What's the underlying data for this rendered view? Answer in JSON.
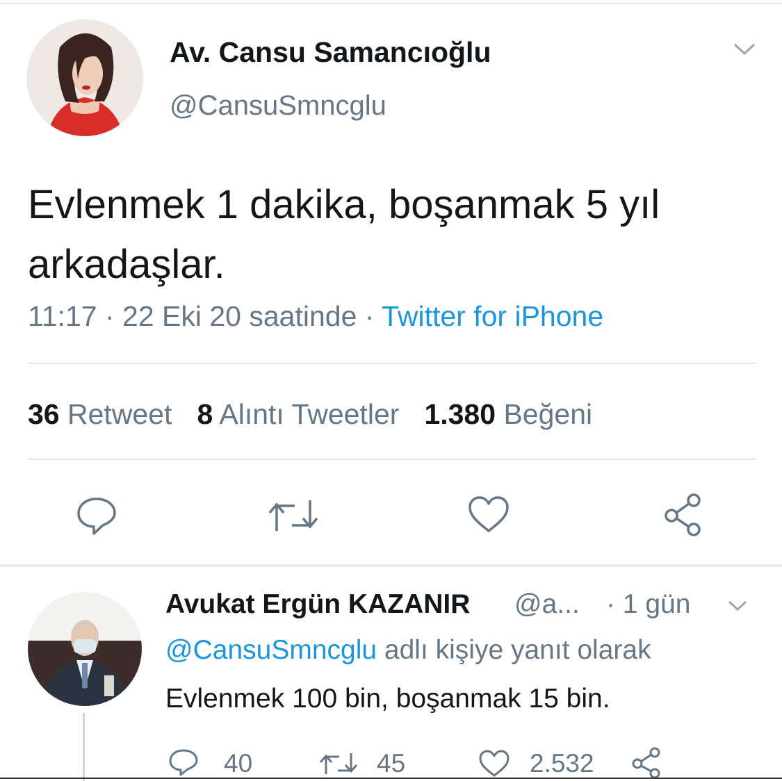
{
  "tweet": {
    "author_name": "Av. Cansu Samancıoğlu",
    "author_handle": "@CansuSmncglu",
    "text": "Evlenmek 1 dakika, boşanmak 5 yıl arkadaşlar.",
    "time": "11:17",
    "date": "22 Eki 20 saatinde",
    "separator": "·",
    "source": "Twitter for iPhone",
    "stats": {
      "retweets_count": "36",
      "retweets_label": "Retweet",
      "quotes_count": "8",
      "quotes_label": "Alıntı Tweetler",
      "likes_count": "1.380",
      "likes_label": "Beğeni"
    },
    "actions": [
      "reply-icon",
      "retweet-icon",
      "like-icon",
      "share-icon"
    ]
  },
  "reply": {
    "author_name": "Avukat Ergün KAZANIR",
    "author_handle": "@a...",
    "time": "· 1 gün",
    "reply_to_handle": "@CansuSmncglu",
    "reply_to_suffix": " adlı kişiye yanıt olarak",
    "text": "Evlenmek 100 bin, boşanmak 15 bin.",
    "reply_count": "40",
    "retweet_count": "45",
    "like_count": "2.532"
  },
  "colors": {
    "primary_text": "#14171a",
    "secondary_text": "#657786",
    "link": "#1b95e0",
    "divider": "#e1e8ed"
  }
}
